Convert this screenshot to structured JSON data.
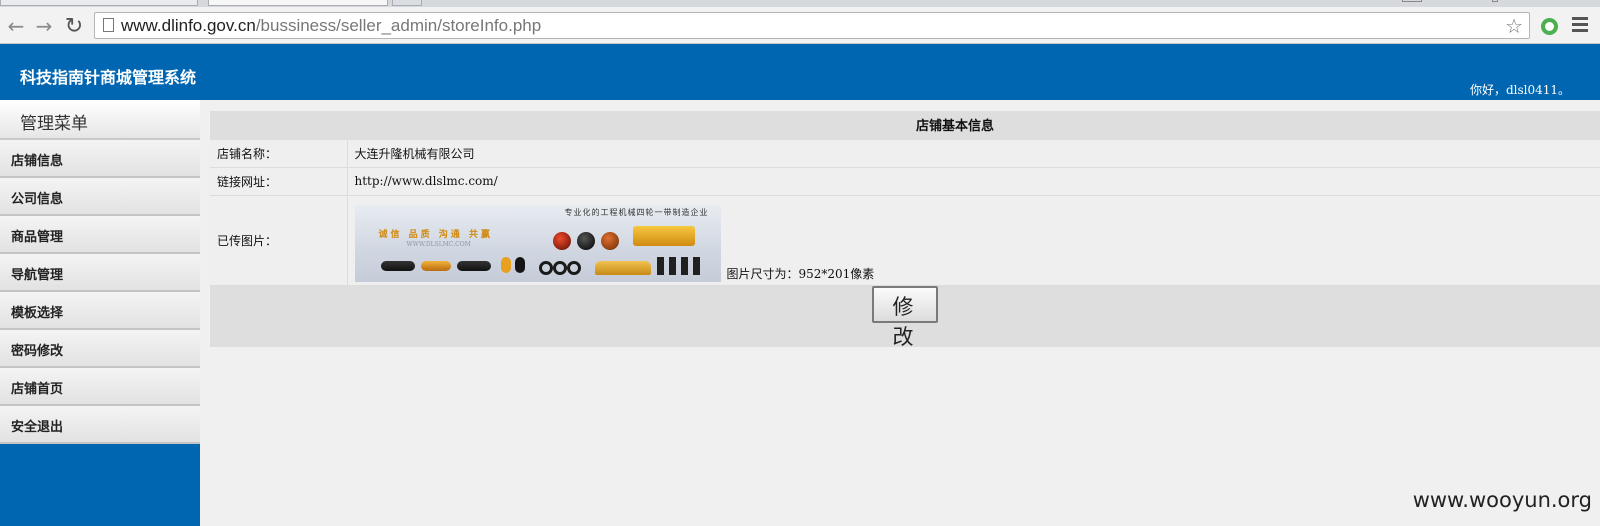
{
  "browser": {
    "url_host": "www.dlinfo.gov.cn",
    "url_path": "/bussiness/seller_admin/storeInfo.php"
  },
  "header": {
    "site_title": "科技指南针商城管理系统",
    "greeting": "你好，dlsl0411。"
  },
  "sidebar": {
    "heading": "管理菜单",
    "items": [
      {
        "label": "店铺信息"
      },
      {
        "label": "公司信息"
      },
      {
        "label": "商品管理"
      },
      {
        "label": "导航管理"
      },
      {
        "label": "模板选择"
      },
      {
        "label": "密码修改"
      },
      {
        "label": "店铺首页"
      },
      {
        "label": "安全退出"
      }
    ]
  },
  "store_info": {
    "title": "店铺基本信息",
    "rows": {
      "name": {
        "label": "店铺名称：",
        "value": "大连升隆机械有限公司"
      },
      "url": {
        "label": "链接网址：",
        "value": "http://www.dlslmc.com/"
      },
      "image": {
        "label": "已传图片：",
        "size_note": "图片尺寸为：952*201像素"
      }
    },
    "banner": {
      "tagline": "专业化的工程机械四轮一带制造企业",
      "slogan": "诚信 品质 沟通 共赢",
      "site": "WWW.DLSLMC.COM"
    },
    "edit_button": "修 改"
  },
  "watermark": "www.wooyun.org",
  "colors": {
    "brand_blue": "#0066b2",
    "panel_gray": "#f0f0f0",
    "accent_gold": "#d08a12"
  }
}
